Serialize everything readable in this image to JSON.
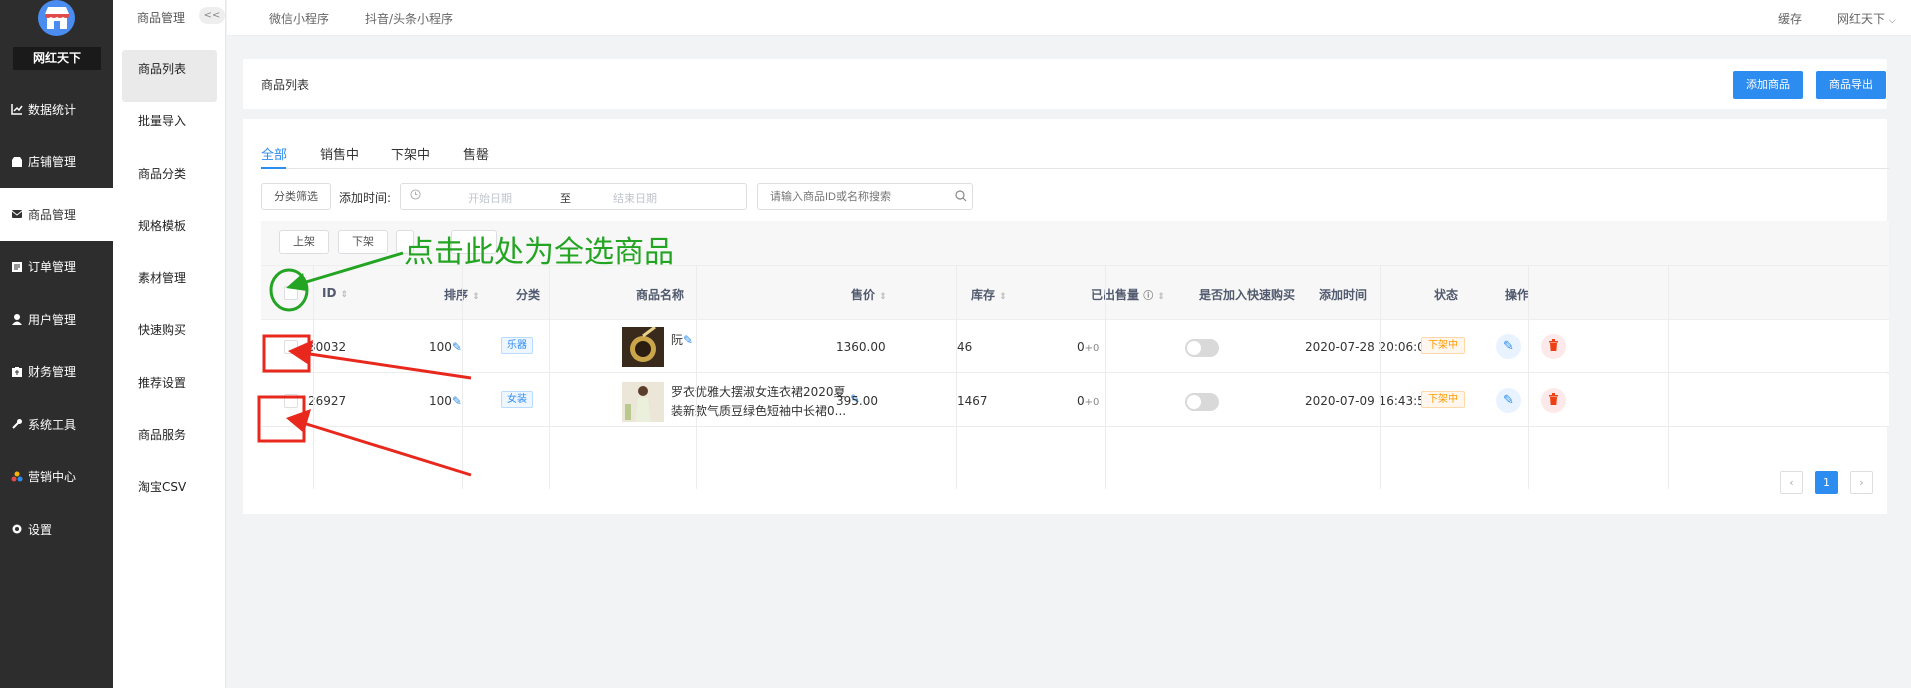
{
  "sidebar": {
    "brand": "网红天下",
    "items": [
      {
        "label": "数据统计",
        "icon": "chart-icon"
      },
      {
        "label": "店铺管理",
        "icon": "shop-icon"
      },
      {
        "label": "商品管理",
        "icon": "goods-icon"
      },
      {
        "label": "订单管理",
        "icon": "order-icon"
      },
      {
        "label": "用户管理",
        "icon": "user-icon"
      },
      {
        "label": "财务管理",
        "icon": "finance-icon"
      },
      {
        "label": "系统工具",
        "icon": "wrench-icon"
      },
      {
        "label": "营销中心",
        "icon": "marketing-icon"
      },
      {
        "label": "设置",
        "icon": "gear-icon"
      }
    ]
  },
  "submenu": {
    "title": "商品管理",
    "collapse": "<<",
    "items": [
      "商品列表",
      "批量导入",
      "商品分类",
      "规格模板",
      "素材管理",
      "快速购买",
      "推荐设置",
      "商品服务",
      "淘宝CSV"
    ]
  },
  "topbar": {
    "links": [
      "微信小程序",
      "抖音/头条小程序"
    ],
    "cache": "缓存",
    "user": "网红天下"
  },
  "page": {
    "title": "商品列表",
    "add_button": "添加商品",
    "export_button": "商品导出"
  },
  "tabs": [
    "全部",
    "销售中",
    "下架中",
    "售罄"
  ],
  "filters": {
    "category_button": "分类筛选",
    "date_label": "添加时间:",
    "start_placeholder": "开始日期",
    "separator": "至",
    "end_placeholder": "结束日期",
    "search_placeholder": "请输入商品ID或名称搜索"
  },
  "bulk": {
    "on_shelf": "上架",
    "off_shelf": "下架"
  },
  "table": {
    "headers": [
      "ID",
      "排序",
      "分类",
      "商品名称",
      "售价",
      "库存",
      "已出售量",
      "是否加入快速购买",
      "添加时间",
      "状态",
      "操作"
    ],
    "rows": [
      {
        "id": "30032",
        "sort": "100",
        "category": "乐器",
        "name": "阮",
        "price": "1360.00",
        "stock": "46",
        "sold": "0",
        "sold_extra": "+0",
        "time": "2020-07-28 20:06:01",
        "status": "下架中"
      },
      {
        "id": "26927",
        "sort": "100",
        "category": "女装",
        "name": "罗衣优雅大摆淑女连衣裙2020夏装新款气质豆绿色短袖中长裙0...",
        "price": "395.00",
        "stock": "1467",
        "sold": "0",
        "sold_extra": "+0",
        "time": "2020-07-09 16:43:53",
        "status": "下架中"
      }
    ]
  },
  "pagination": {
    "current": "1"
  },
  "annotation": {
    "text": "点击此处为全选商品"
  },
  "colors": {
    "accent": "#2d8cf0",
    "sidebar": "#2d2d2d",
    "annotation_green": "#23a423",
    "annotation_red": "#e8281d"
  }
}
